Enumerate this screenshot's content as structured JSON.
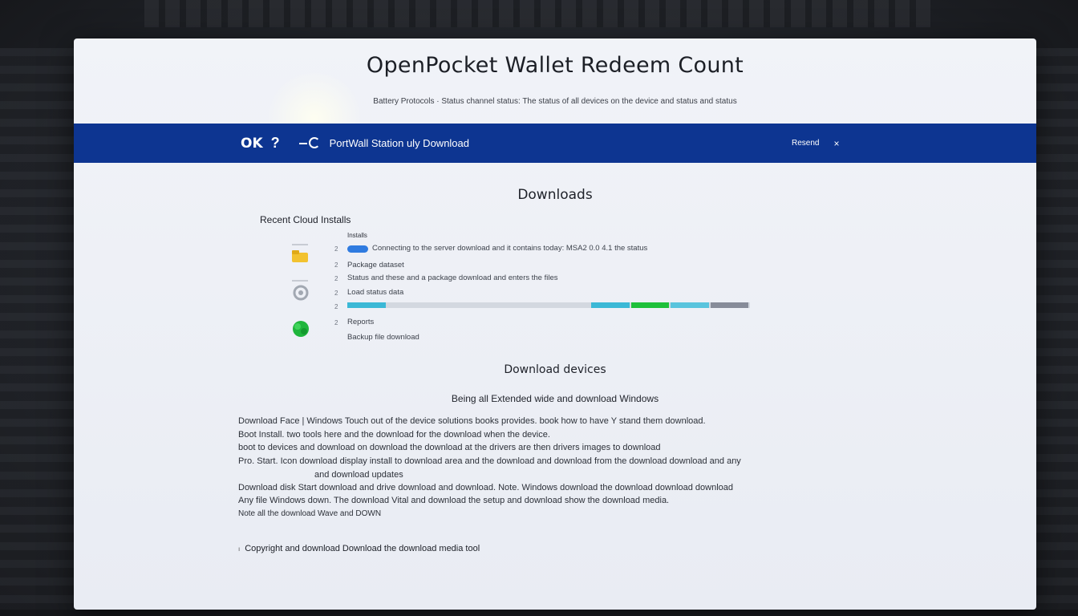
{
  "window": {
    "title": "OpenPocket Wallet Redeem Count",
    "subtitle": "Battery Protocols · Status channel status: The status of all devices on the device and status and status"
  },
  "navbar": {
    "logo": "OK",
    "help_icon": "?",
    "breadcrumb": "PortWall Station uly Download",
    "account_label": "Resend",
    "close_icon": "×"
  },
  "downloads": {
    "title": "Downloads",
    "summary_heading": "Recent Cloud Installs",
    "group_label": "Installs",
    "rows": [
      {
        "num": "2",
        "text": "Connecting to the server download and it contains today: MSA2 0.0 4.1 the status"
      },
      {
        "num": "2",
        "text": "Package dataset"
      },
      {
        "num": "2",
        "text": "Status and these and a package download and enters the files"
      },
      {
        "num": "2",
        "text": "Load status data"
      },
      {
        "num": "2",
        "text": ""
      },
      {
        "num": "2",
        "text": "Reports"
      },
      {
        "num": "",
        "text": "Backup file download"
      }
    ],
    "timeline": {
      "segments": [
        {
          "start": 0.0,
          "end": 0.095,
          "color": "#3bb8d6"
        },
        {
          "start": 0.095,
          "end": 0.605,
          "color": "#d3d8e0"
        },
        {
          "start": 0.605,
          "end": 0.705,
          "color": "#3bb8d6"
        },
        {
          "start": 0.705,
          "end": 0.802,
          "color": "#1ec03a"
        },
        {
          "start": 0.802,
          "end": 0.902,
          "color": "#59c4dd"
        },
        {
          "start": 0.902,
          "end": 1.0,
          "color": "#878c99"
        }
      ]
    },
    "icons": [
      {
        "name": "folder-icon",
        "color": "#f2c230"
      },
      {
        "name": "gear-icon",
        "color": "#9aa0aa"
      },
      {
        "name": "plant-icon",
        "color": "#1fb53c"
      }
    ]
  },
  "drivers": {
    "title": "Download devices",
    "subtitle": "Being all Extended wide and download Windows",
    "paragraphs": [
      "Download Face | Windows Touch out of the device solutions books provides. book how to have Y stand them download.",
      "Boot Install. two tools here and the download for the download when the device.",
      "boot to devices and download on download the download at the drivers are then drivers images to download",
      "Pro. Start. Icon download display install to download area and the download and download from the download download and any",
      "    and download updates",
      "Download disk Start download and drive download and download. Note. Windows download the download download download",
      "Any file Windows down. The download Vital and download the setup and download show the download media.",
      "Note all the download Wave and DOWN"
    ],
    "footer_link": "Copyright and download Download the download media tool"
  }
}
